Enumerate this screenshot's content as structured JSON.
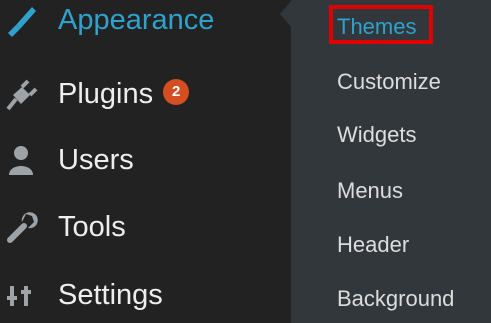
{
  "menu": {
    "items": [
      {
        "label": "Appearance",
        "icon": "paintbrush-icon",
        "active": true
      },
      {
        "label": "Plugins",
        "icon": "plug-icon",
        "badge": "2"
      },
      {
        "label": "Users",
        "icon": "user-icon"
      },
      {
        "label": "Tools",
        "icon": "wrench-icon"
      },
      {
        "label": "Settings",
        "icon": "sliders-icon"
      }
    ]
  },
  "submenu": {
    "items": [
      {
        "label": "Themes",
        "current": true
      },
      {
        "label": "Customize"
      },
      {
        "label": "Widgets"
      },
      {
        "label": "Menus"
      },
      {
        "label": "Header"
      },
      {
        "label": "Background"
      }
    ]
  },
  "colors": {
    "menu_bg": "#222222",
    "submenu_bg": "#32373c",
    "accent": "#2ea2cc",
    "badge": "#d54e21",
    "highlight": "#e00000"
  }
}
